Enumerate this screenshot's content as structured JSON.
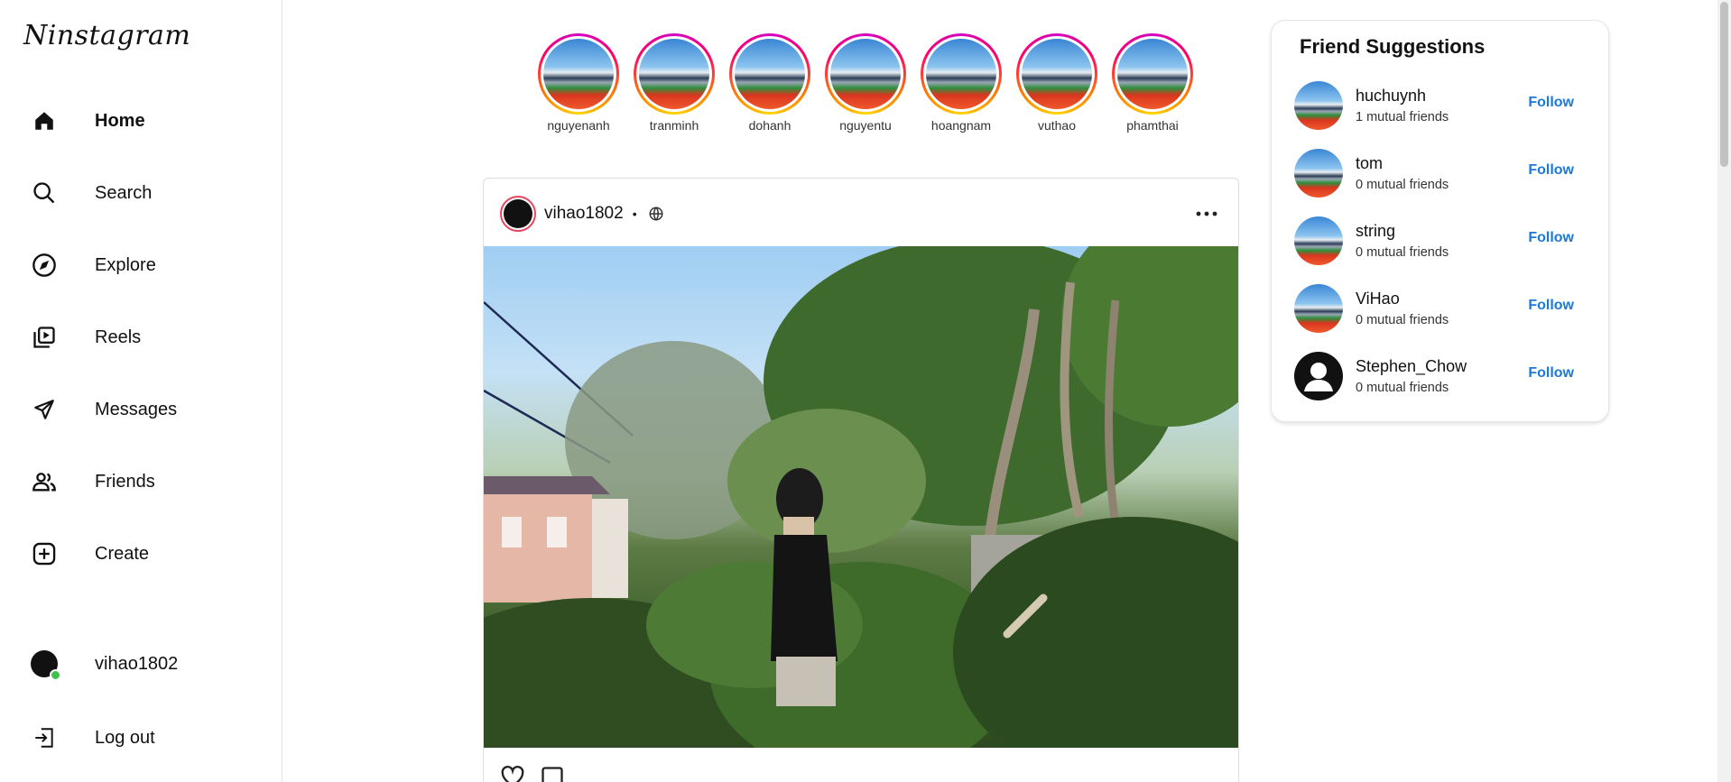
{
  "app": {
    "logo": "Ninstagram"
  },
  "sidebar": {
    "items": [
      {
        "label": "Home",
        "icon": "home-icon"
      },
      {
        "label": "Search",
        "icon": "search-icon"
      },
      {
        "label": "Explore",
        "icon": "compass-icon"
      },
      {
        "label": "Reels",
        "icon": "reels-icon"
      },
      {
        "label": "Messages",
        "icon": "send-icon"
      },
      {
        "label": "Friends",
        "icon": "friends-icon"
      },
      {
        "label": "Create",
        "icon": "plus-square-icon"
      }
    ],
    "profile_label": "vihao1802",
    "logout_label": "Log out"
  },
  "stories": [
    {
      "username": "nguyenanh"
    },
    {
      "username": "tranminh"
    },
    {
      "username": "dohanh"
    },
    {
      "username": "nguyentu"
    },
    {
      "username": "hoangnam"
    },
    {
      "username": "vuthao"
    },
    {
      "username": "phamthai"
    }
  ],
  "post": {
    "username": "vihao1802",
    "separator": "•",
    "visibility_icon": "globe-icon"
  },
  "suggestions": {
    "title": "Friend Suggestions",
    "follow_label": "Follow",
    "items": [
      {
        "name": "huchuynh",
        "mutual": "1 mutual friends"
      },
      {
        "name": "tom",
        "mutual": "0 mutual friends"
      },
      {
        "name": "string",
        "mutual": "0 mutual friends"
      },
      {
        "name": "ViHao",
        "mutual": "0 mutual friends"
      },
      {
        "name": "Stephen_Chow",
        "mutual": "0 mutual friends"
      }
    ]
  },
  "colors": {
    "accent_link": "#1e78d6",
    "online": "#3ec24a"
  }
}
